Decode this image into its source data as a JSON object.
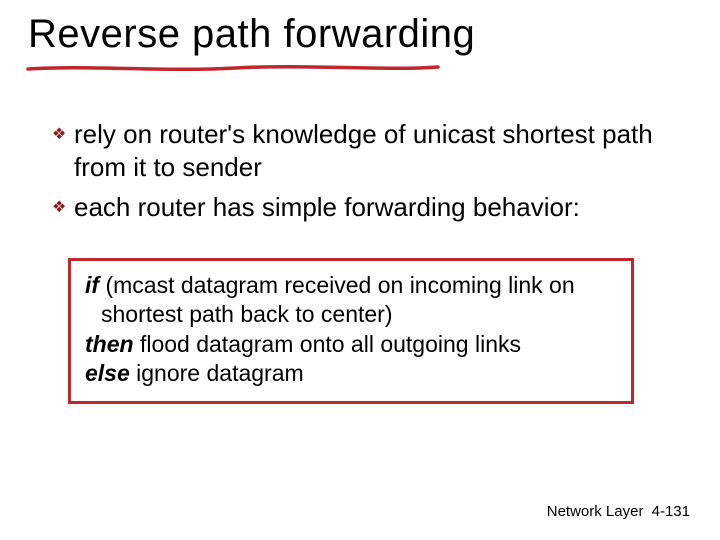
{
  "title": "Reverse path forwarding",
  "bullets": [
    "rely on router's knowledge of unicast shortest path from it  to sender",
    "each router has simple forwarding behavior:"
  ],
  "algo": {
    "kw_if": "if",
    "cond1": " (mcast datagram received on incoming link on",
    "cond2": "shortest path back to center)",
    "kw_then": "then",
    "then_rest": " flood datagram onto all outgoing links",
    "kw_else": "else",
    "else_rest": " ignore datagram"
  },
  "footer": {
    "label": "Network Layer",
    "page": "4-131"
  },
  "colors": {
    "accent_red": "#c0272d",
    "bullet_maroon": "#8a1a1a"
  }
}
